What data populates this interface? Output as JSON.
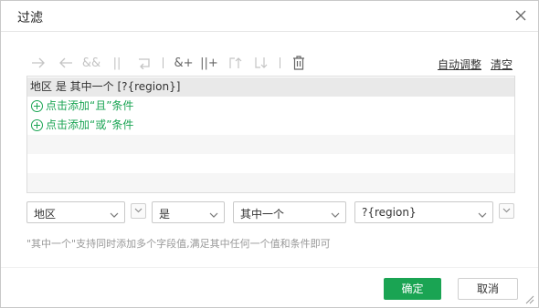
{
  "dialog": {
    "title": "过滤",
    "close_icon": "close-icon"
  },
  "toolbar": {
    "icons": [
      "arrow-right-icon",
      "arrow-left-icon",
      "and-icon",
      "or-icon",
      "swap-icon",
      "add-and-icon",
      "add-or-icon",
      "move-up-icon",
      "move-down-icon",
      "delete-icon"
    ],
    "and_label": "&&",
    "or_label": "||",
    "add_and_label": "&+",
    "add_or_label": "||+",
    "auto_adjust": "自动调整",
    "clear": "清空"
  },
  "conditions": {
    "selected": "地区 是 其中一个 [?{region}]",
    "add_and": "点击添加“且”条件",
    "add_or": "点击添加“或”条件"
  },
  "editor": {
    "field": "地区",
    "operator": "是",
    "mode": "其中一个",
    "value": "?{region}"
  },
  "hint": "\"其中一个\"支持同时添加多个字段值,满足其中任何一个值和条件即可",
  "buttons": {
    "ok": "确定",
    "cancel": "取消"
  },
  "colors": {
    "accent": "#1aa453",
    "selected_row": "#e9e9e9"
  }
}
